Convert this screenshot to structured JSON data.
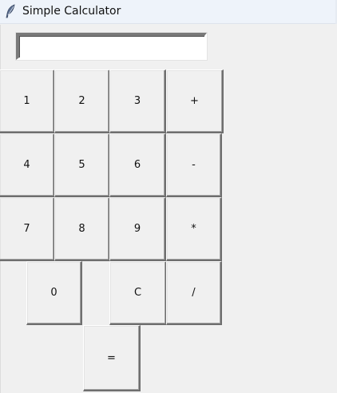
{
  "window": {
    "title": "Simple Calculator",
    "icon": "feather-icon"
  },
  "display": {
    "value": "",
    "placeholder": ""
  },
  "buttons": {
    "b1": "1",
    "b2": "2",
    "b3": "3",
    "add": "+",
    "b4": "4",
    "b5": "5",
    "b6": "6",
    "subtract": "-",
    "b7": "7",
    "b8": "8",
    "b9": "9",
    "multiply": "*",
    "b0": "0",
    "clear": "C",
    "divide": "/",
    "equals": "="
  }
}
